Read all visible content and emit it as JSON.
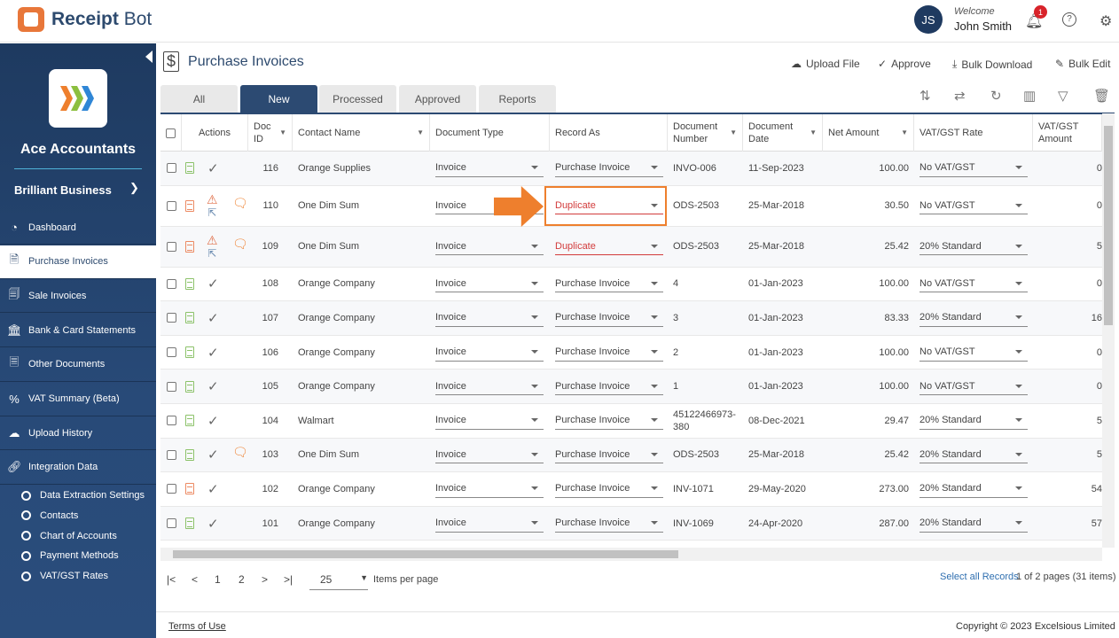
{
  "app": {
    "name_bold": "Receipt",
    "name_light": "Bot"
  },
  "user": {
    "initials": "JS",
    "welcome": "Welcome",
    "name": "John Smith",
    "notifications": "1"
  },
  "sidebar": {
    "org": "Ace Accountants",
    "business": "Brilliant Business",
    "items": [
      {
        "label": "Dashboard",
        "icon": "gauge-icon"
      },
      {
        "label": "Purchase Invoices",
        "icon": "invoice-icon"
      },
      {
        "label": "Sale Invoices",
        "icon": "sale-icon"
      },
      {
        "label": "Bank & Card Statements",
        "icon": "bank-icon"
      },
      {
        "label": "Other Documents",
        "icon": "document-icon"
      },
      {
        "label": "VAT Summary (Beta)",
        "icon": "percent-icon"
      },
      {
        "label": "Upload History",
        "icon": "upload-cloud-icon"
      },
      {
        "label": "Integration Data",
        "icon": "link-icon"
      }
    ],
    "subitems": [
      "Data Extraction Settings",
      "Contacts",
      "Chart of Accounts",
      "Payment Methods",
      "VAT/GST Rates"
    ]
  },
  "page": {
    "title": "Purchase Invoices",
    "actions": [
      "Upload File",
      "Approve",
      "Bulk Download",
      "Bulk Edit"
    ],
    "tabs": [
      "All",
      "New",
      "Processed",
      "Approved",
      "Reports"
    ],
    "active_tab": "New"
  },
  "table": {
    "headers": [
      "Actions",
      "Doc ID",
      "Contact Name",
      "Document Type",
      "Record As",
      "Document Number",
      "Document Date",
      "Net Amount",
      "VAT/GST Rate",
      "VAT/GST Amount"
    ],
    "rows": [
      {
        "status": "ok",
        "doc_color": "green",
        "comment": false,
        "id": "116",
        "contact": "Orange Supplies",
        "type": "Invoice",
        "record": "Purchase Invoice",
        "number": "INVO-006",
        "date": "11-Sep-2023",
        "net": "100.00",
        "rate": "No VAT/GST",
        "vat": "0"
      },
      {
        "status": "warn",
        "doc_color": "orange",
        "comment": true,
        "id": "110",
        "contact": "One Dim Sum",
        "type": "Invoice",
        "record": "Duplicate",
        "number": "ODS-2503",
        "date": "25-Mar-2018",
        "net": "30.50",
        "rate": "No VAT/GST",
        "vat": "0"
      },
      {
        "status": "warn",
        "doc_color": "orange",
        "comment": true,
        "id": "109",
        "contact": "One Dim Sum",
        "type": "Invoice",
        "record": "Duplicate",
        "number": "ODS-2503",
        "date": "25-Mar-2018",
        "net": "25.42",
        "rate": "20% Standard",
        "vat": "5"
      },
      {
        "status": "ok",
        "doc_color": "green",
        "comment": false,
        "id": "108",
        "contact": "Orange Company",
        "type": "Invoice",
        "record": "Purchase Invoice",
        "number": "4",
        "date": "01-Jan-2023",
        "net": "100.00",
        "rate": "No VAT/GST",
        "vat": "0"
      },
      {
        "status": "ok",
        "doc_color": "green",
        "comment": false,
        "id": "107",
        "contact": "Orange Company",
        "type": "Invoice",
        "record": "Purchase Invoice",
        "number": "3",
        "date": "01-Jan-2023",
        "net": "83.33",
        "rate": "20% Standard",
        "vat": "16"
      },
      {
        "status": "ok",
        "doc_color": "green",
        "comment": false,
        "id": "106",
        "contact": "Orange Company",
        "type": "Invoice",
        "record": "Purchase Invoice",
        "number": "2",
        "date": "01-Jan-2023",
        "net": "100.00",
        "rate": "No VAT/GST",
        "vat": "0"
      },
      {
        "status": "ok",
        "doc_color": "green",
        "comment": false,
        "id": "105",
        "contact": "Orange Company",
        "type": "Invoice",
        "record": "Purchase Invoice",
        "number": "1",
        "date": "01-Jan-2023",
        "net": "100.00",
        "rate": "No VAT/GST",
        "vat": "0"
      },
      {
        "status": "ok",
        "doc_color": "green",
        "comment": false,
        "id": "104",
        "contact": "Walmart",
        "type": "Invoice",
        "record": "Purchase Invoice",
        "number": "45122466973-380",
        "date": "08-Dec-2021",
        "net": "29.47",
        "rate": "20% Standard",
        "vat": "5"
      },
      {
        "status": "ok",
        "doc_color": "green",
        "comment": true,
        "id": "103",
        "contact": "One Dim Sum",
        "type": "Invoice",
        "record": "Purchase Invoice",
        "number": "ODS-2503",
        "date": "25-Mar-2018",
        "net": "25.42",
        "rate": "20% Standard",
        "vat": "5"
      },
      {
        "status": "ok",
        "doc_color": "orange",
        "comment": false,
        "id": "102",
        "contact": "Orange Company",
        "type": "Invoice",
        "record": "Purchase Invoice",
        "number": "INV-1071",
        "date": "29-May-2020",
        "net": "273.00",
        "rate": "20% Standard",
        "vat": "54"
      },
      {
        "status": "ok",
        "doc_color": "green",
        "comment": false,
        "id": "101",
        "contact": "Orange Company",
        "type": "Invoice",
        "record": "Purchase Invoice",
        "number": "INV-1069",
        "date": "24-Apr-2020",
        "net": "287.00",
        "rate": "20% Standard",
        "vat": "57"
      }
    ]
  },
  "pagination": {
    "pages": [
      "1",
      "2"
    ],
    "page_size": "25",
    "items_label": "Items per page",
    "select_all": "Select all Records",
    "summary": "1 of 2 pages (31 items)"
  },
  "footer": {
    "terms": "Terms of Use",
    "copyright": "Copyright © 2023 Excelsious Limited"
  },
  "colors": {
    "navy": "#1e3a60",
    "accent": "#ee7f2d",
    "duplicate": "#d23b3b",
    "doc_green": "#8cc26a",
    "doc_orange": "#ec8a63"
  }
}
